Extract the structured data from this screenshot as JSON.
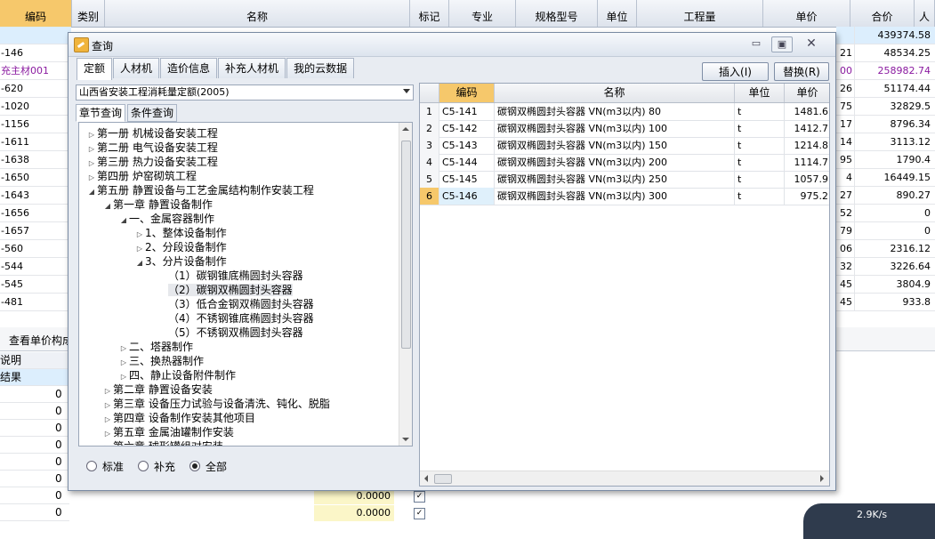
{
  "background": {
    "columns": [
      {
        "label": "编码",
        "w": 81
      },
      {
        "label": "类别",
        "w": 37
      },
      {
        "label": "名称",
        "w": 343
      },
      {
        "label": "标记",
        "w": 44
      },
      {
        "label": "专业",
        "w": 75
      },
      {
        "label": "规格型号",
        "w": 92
      },
      {
        "label": "单位",
        "w": 44
      },
      {
        "label": "工程量",
        "w": 142
      },
      {
        "label": "单价",
        "w": 98
      },
      {
        "label": "合价",
        "w": 72
      },
      {
        "label": "人",
        "w": 23
      }
    ],
    "left_codes": [
      "",
      "-146",
      "充主材001",
      "-620",
      "-1020",
      "-1156",
      "-1611",
      "-1638",
      "-1650",
      "-1643",
      "-1656",
      "-1657",
      "-560",
      "-544",
      "-545",
      "-481"
    ],
    "right_rows": [
      {
        "p": "",
        "t": "439374.58"
      },
      {
        "p": "21",
        "t": "48534.25"
      },
      {
        "p": "00",
        "t": "258982.74"
      },
      {
        "p": "26",
        "t": "51174.44"
      },
      {
        "p": "75",
        "t": "32829.5"
      },
      {
        "p": "17",
        "t": "8796.34"
      },
      {
        "p": "14",
        "t": "3113.12"
      },
      {
        "p": "95",
        "t": "1790.4"
      },
      {
        "p": "4",
        "t": "16449.15"
      },
      {
        "p": "27",
        "t": "890.27"
      },
      {
        "p": "52",
        "t": "0"
      },
      {
        "p": "79",
        "t": "0"
      },
      {
        "p": "06",
        "t": "2316.12"
      },
      {
        "p": "32",
        "t": "3226.64"
      },
      {
        "p": "45",
        "t": "3804.9"
      },
      {
        "p": "45",
        "t": "933.8"
      }
    ],
    "lower_tab": "查看单价构成",
    "lower_labels": [
      "说明",
      "结果"
    ],
    "lower_zero": "0",
    "lower_values": [
      "0.0000",
      "0.0000"
    ]
  },
  "dialog": {
    "title": "查询",
    "tabs": [
      "定额",
      "人材机",
      "造价信息",
      "补充人材机",
      "我的云数据"
    ],
    "insert_button": "插入(I)",
    "replace_button": "替换(R)",
    "library": "山西省安装工程消耗量定额(2005)",
    "subtabs": [
      "章节查询",
      "条件查询"
    ],
    "tree": [
      {
        "label": "第一册 机械设备安装工程",
        "level": 0,
        "exp": "▷"
      },
      {
        "label": "第二册 电气设备安装工程",
        "level": 0,
        "exp": "▷"
      },
      {
        "label": "第三册 热力设备安装工程",
        "level": 0,
        "exp": "▷"
      },
      {
        "label": "第四册 炉窑砌筑工程",
        "level": 0,
        "exp": "▷"
      },
      {
        "label": "第五册 静置设备与工艺金属结构制作安装工程",
        "level": 0,
        "exp": "◢"
      },
      {
        "label": "第一章 静置设备制作",
        "level": 1,
        "exp": "◢"
      },
      {
        "label": "一、金属容器制作",
        "level": 2,
        "exp": "◢"
      },
      {
        "label": "1、整体设备制作",
        "level": 3,
        "exp": "▷"
      },
      {
        "label": "2、分段设备制作",
        "level": 3,
        "exp": "▷"
      },
      {
        "label": "3、分片设备制作",
        "level": 3,
        "exp": "◢"
      },
      {
        "label": "（1）碳钢锥底椭圆封头容器",
        "level": 4,
        "exp": ""
      },
      {
        "label": "（2）碳钢双椭圆封头容器",
        "level": 4,
        "exp": "",
        "sel": true
      },
      {
        "label": "（3）低合金钢双椭圆封头容器",
        "level": 4,
        "exp": ""
      },
      {
        "label": "（4）不锈钢锥底椭圆封头容器",
        "level": 4,
        "exp": ""
      },
      {
        "label": "（5）不锈钢双椭圆封头容器",
        "level": 4,
        "exp": ""
      },
      {
        "label": "二、塔器制作",
        "level": 2,
        "exp": "▷"
      },
      {
        "label": "三、换热器制作",
        "level": 2,
        "exp": "▷"
      },
      {
        "label": "四、静止设备附件制作",
        "level": 2,
        "exp": "▷"
      },
      {
        "label": "第二章 静置设备安装",
        "level": 1,
        "exp": "▷"
      },
      {
        "label": "第三章 设备压力试验与设备清洗、钝化、脱脂",
        "level": 1,
        "exp": "▷"
      },
      {
        "label": "第四章 设备制作安装其他项目",
        "level": 1,
        "exp": "▷"
      },
      {
        "label": "第五章 金属油罐制作安装",
        "level": 1,
        "exp": "▷"
      },
      {
        "label": "第六章 球形罐组对安装",
        "level": 1,
        "exp": "▷"
      }
    ],
    "radios": [
      {
        "label": "标准",
        "checked": false
      },
      {
        "label": "补充",
        "checked": false
      },
      {
        "label": "全部",
        "checked": true
      }
    ],
    "grid": {
      "headers": [
        "",
        "编码",
        "名称",
        "单位",
        "单价"
      ],
      "rows": [
        {
          "n": "1",
          "code": "C5-141",
          "name": "碳钢双椭圆封头容器 VN(m3以内) 80",
          "unit": "t",
          "price": "1481.6"
        },
        {
          "n": "2",
          "code": "C5-142",
          "name": "碳钢双椭圆封头容器 VN(m3以内) 100",
          "unit": "t",
          "price": "1412.7"
        },
        {
          "n": "3",
          "code": "C5-143",
          "name": "碳钢双椭圆封头容器 VN(m3以内) 150",
          "unit": "t",
          "price": "1214.8"
        },
        {
          "n": "4",
          "code": "C5-144",
          "name": "碳钢双椭圆封头容器 VN(m3以内) 200",
          "unit": "t",
          "price": "1114.7"
        },
        {
          "n": "5",
          "code": "C5-145",
          "name": "碳钢双椭圆封头容器 VN(m3以内) 250",
          "unit": "t",
          "price": "1057.9"
        },
        {
          "n": "6",
          "code": "C5-146",
          "name": "碳钢双椭圆封头容器 VN(m3以内) 300",
          "unit": "t",
          "price": "975.2",
          "sel": true
        }
      ]
    }
  },
  "network": {
    "speed": "2.9K/s"
  }
}
